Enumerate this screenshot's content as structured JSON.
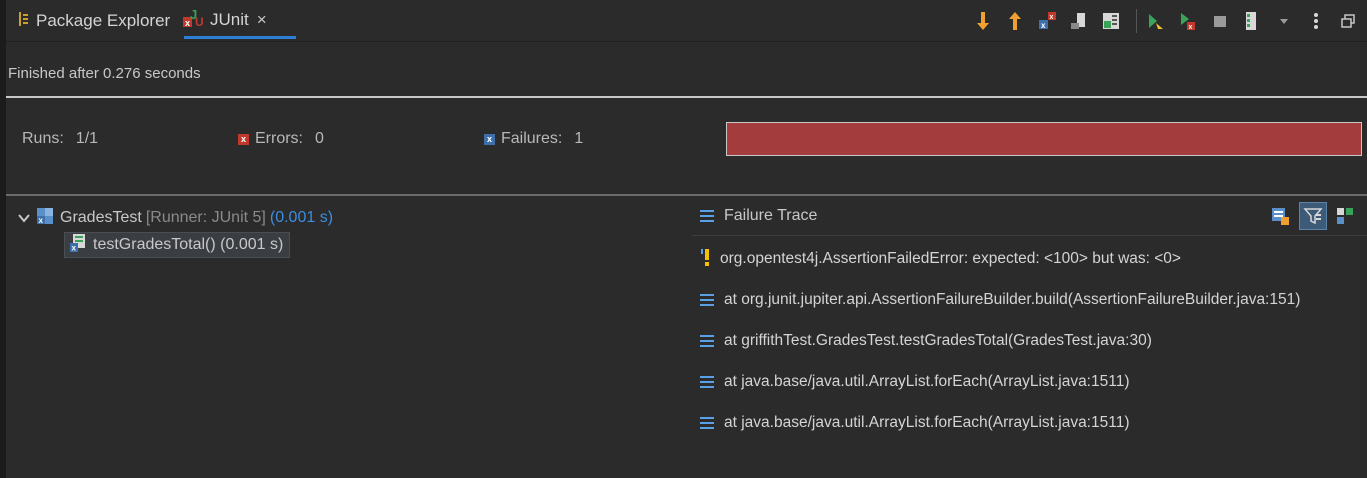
{
  "tabs": {
    "package_explorer": "Package Explorer",
    "junit": "JUnit",
    "close": "×"
  },
  "status": "Finished after 0.276 seconds",
  "counters": {
    "runs_label": "Runs:",
    "runs_value": "1/1",
    "errors_label": "Errors:",
    "errors_value": "0",
    "failures_label": "Failures:",
    "failures_value": "1"
  },
  "progress": {
    "state": "failed",
    "fraction": 1.0,
    "color": "#a33c3c"
  },
  "tree": {
    "suite": {
      "name": "GradesTest",
      "runner": "[Runner: JUnit 5]",
      "time": "(0.001 s)"
    },
    "test": {
      "name": "testGradesTotal() (0.001 s)"
    }
  },
  "trace": {
    "title": "Failure Trace",
    "lines": [
      "org.opentest4j.AssertionFailedError: expected: <100> but was: <0>",
      "at org.junit.jupiter.api.AssertionFailureBuilder.build(AssertionFailureBuilder.java:151)",
      "at griffithTest.GradesTest.testGradesTotal(GradesTest.java:30)",
      "at java.base/java.util.ArrayList.forEach(ArrayList.java:1511)",
      "at java.base/java.util.ArrayList.forEach(ArrayList.java:1511)"
    ]
  },
  "icons": {
    "toolbar": [
      "next-failure-icon",
      "previous-failure-icon",
      "show-failures-only-icon",
      "scroll-lock-icon",
      "show-skipped-icon",
      "rerun-icon",
      "rerun-failed-first-icon",
      "stop-icon",
      "history-icon",
      "dropdown-icon",
      "view-menu-icon",
      "minimize-icon"
    ]
  },
  "colors": {
    "accent": "#2d7fd6",
    "error": "#a33c3c",
    "time": "#3b8ee0"
  }
}
